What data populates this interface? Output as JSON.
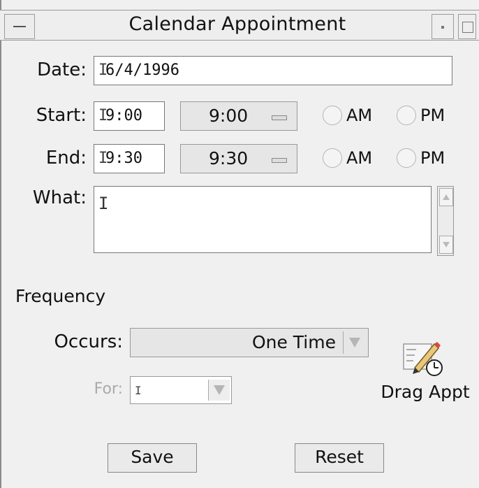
{
  "window": {
    "title": "Calendar Appointment"
  },
  "date": {
    "label": "Date:",
    "value": "6/4/1996"
  },
  "start": {
    "label": "Start:",
    "value": "9:00",
    "menu_value": "9:00",
    "am": "AM",
    "pm": "PM"
  },
  "end": {
    "label": "End:",
    "value": "9:30",
    "menu_value": "9:30",
    "am": "AM",
    "pm": "PM"
  },
  "what": {
    "label": "What:",
    "value": ""
  },
  "frequency": {
    "section_label": "Frequency",
    "occurs_label": "Occurs:",
    "occurs_value": "One Time",
    "for_label": "For:",
    "for_value": ""
  },
  "drag": {
    "label": "Drag Appt",
    "icon": "pencil-clock-icon"
  },
  "buttons": {
    "save": "Save",
    "reset": "Reset"
  }
}
